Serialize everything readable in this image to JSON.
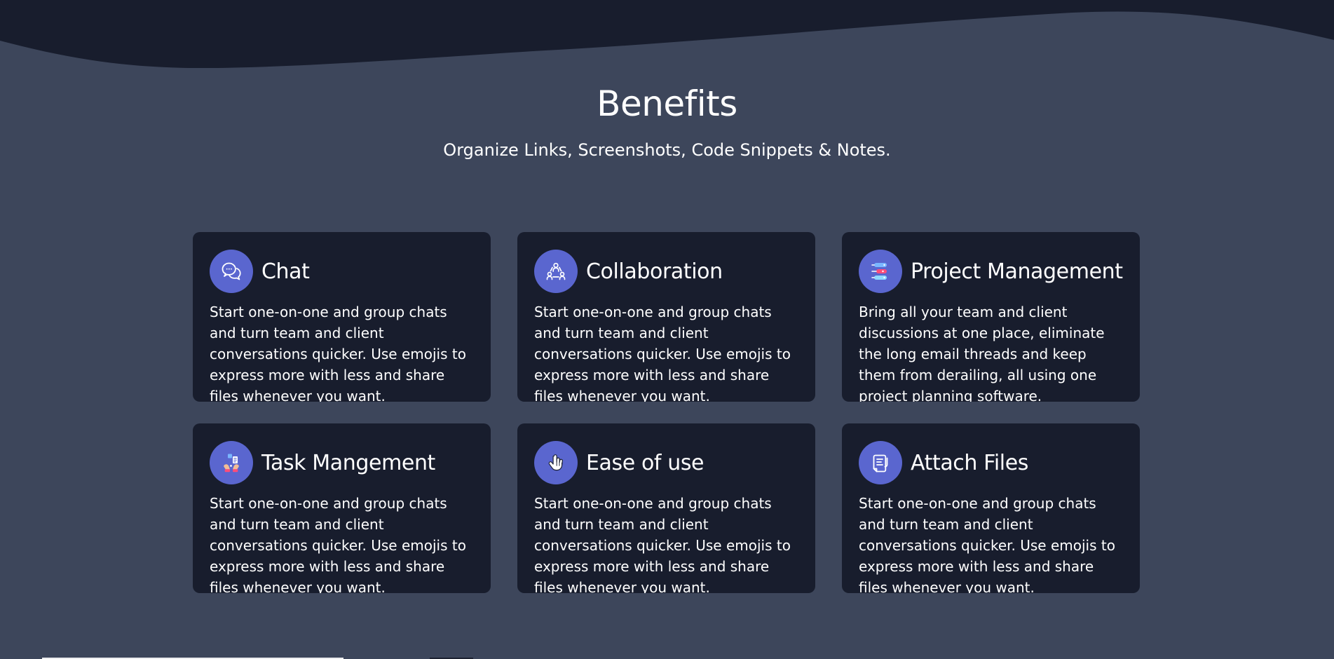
{
  "hero": {
    "title": "Benefits",
    "subtitle": "Organize Links, Screenshots, Code Snippets & Notes."
  },
  "cards": [
    {
      "title": "Chat",
      "text": "Start one-on-one and group chats and turn team and client conversations quicker. Use emojis to express more with less and share files whenever you want.",
      "icon": "chat-bubble-icon"
    },
    {
      "title": "Collaboration",
      "text": "Start one-on-one and group chats and turn team and client conversations quicker. Use emojis to express more with less and share files whenever you want.",
      "icon": "collaboration-icon"
    },
    {
      "title": "Project Management",
      "text": "Bring all your team and client discussions at one place, eliminate the long email threads and keep them from derailing, all using one project planning software.",
      "icon": "project-board-icon"
    },
    {
      "title": "Task Mangement",
      "text": "Start one-on-one and group chats and turn team and client conversations quicker. Use emojis to express more with less and share files whenever you want.",
      "icon": "task-hands-icon"
    },
    {
      "title": "Ease of use",
      "text": "Start one-on-one and group chats and turn team and client conversations quicker. Use emojis to express more with less and share files whenever you want.",
      "icon": "hand-pointer-icon"
    },
    {
      "title": "Attach Files",
      "text": "Start one-on-one and group chats and turn team and client conversations quicker. Use emojis to express more with less and share files whenever you want.",
      "icon": "document-icon"
    }
  ],
  "colors": {
    "background": "#3d465b",
    "wave": "#181d2d",
    "card": "#181d2d",
    "icon_circle": "#5a66cf",
    "text": "#ffffff"
  }
}
